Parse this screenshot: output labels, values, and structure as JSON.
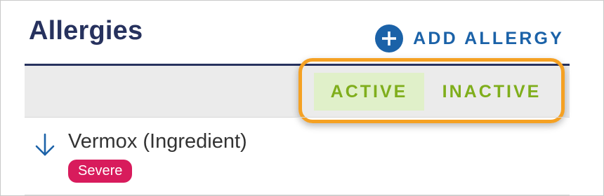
{
  "header": {
    "title": "Allergies",
    "add_button_label": "ADD ALLERGY"
  },
  "filters": {
    "tabs": [
      {
        "label": "ACTIVE",
        "selected": true
      },
      {
        "label": "INACTIVE",
        "selected": false
      }
    ]
  },
  "allergies": [
    {
      "name": "Vermox (Ingredient)",
      "severity": "Severe",
      "sort_icon": "arrow-down-icon"
    }
  ],
  "colors": {
    "title": "#27325e",
    "accent_blue": "#1b62a8",
    "tab_green": "#7fae1c",
    "active_tab_bg": "#e0f0c9",
    "highlight_orange": "#f5a123",
    "severe_badge": "#d81b5c",
    "filter_bar_bg": "#ebebeb"
  }
}
